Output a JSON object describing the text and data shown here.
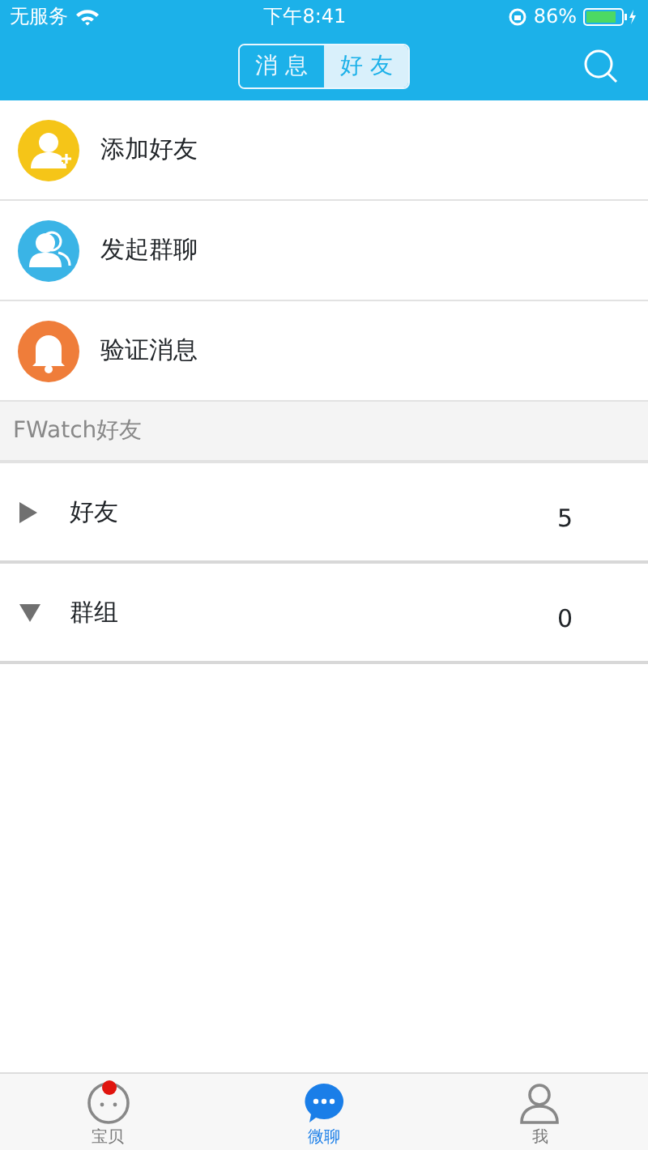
{
  "status_bar": {
    "carrier": "无服务",
    "time": "下午8:41",
    "battery": "86%"
  },
  "segments": [
    {
      "label": "消 息",
      "selected": false
    },
    {
      "label": "好 友",
      "selected": true
    }
  ],
  "actions": [
    {
      "label": "添加好友",
      "kind": "add-friend",
      "color": "#f5c518"
    },
    {
      "label": "发起群聊",
      "kind": "group",
      "color": "#3ab4e6"
    },
    {
      "label": "验证消息",
      "kind": "bell",
      "color": "#ef7d3a"
    }
  ],
  "section_header": "FWatch好友",
  "groups": [
    {
      "label": "好友",
      "count": "5",
      "expanded": false
    },
    {
      "label": "群组",
      "count": "0",
      "expanded": true
    }
  ],
  "tab_bar": [
    {
      "label": "宝贝",
      "kind": "face",
      "selected": false,
      "badge": true
    },
    {
      "label": "微聊",
      "kind": "chat",
      "selected": true,
      "badge": false
    },
    {
      "label": "我",
      "kind": "person",
      "selected": false,
      "badge": false
    }
  ]
}
